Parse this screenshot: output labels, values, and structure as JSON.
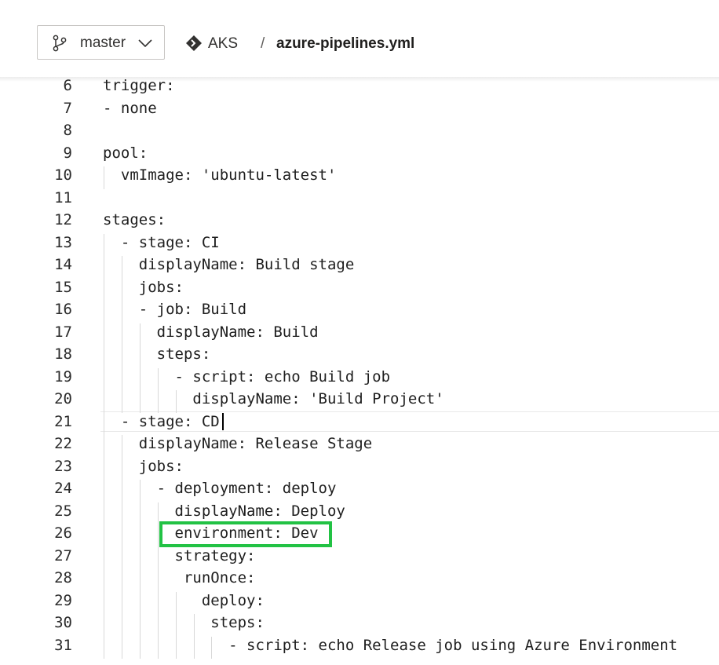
{
  "header": {
    "branch": "master",
    "repo": "AKS",
    "path_separator": "/",
    "file": "azure-pipelines.yml"
  },
  "icons": {
    "branch": "git-branch-icon",
    "chevron": "chevron-down-icon",
    "repo": "repo-diamond-icon"
  },
  "colors": {
    "highlight": "#22c244"
  },
  "editor": {
    "current_line": 21,
    "highlighted_line": 26,
    "lines": [
      {
        "n": "6",
        "code": "trigger:"
      },
      {
        "n": "7",
        "code": "- none"
      },
      {
        "n": "8",
        "code": ""
      },
      {
        "n": "9",
        "code": "pool:"
      },
      {
        "n": "10",
        "code": "  vmImage: 'ubuntu-latest'"
      },
      {
        "n": "11",
        "code": ""
      },
      {
        "n": "12",
        "code": "stages:"
      },
      {
        "n": "13",
        "code": "  - stage: CI"
      },
      {
        "n": "14",
        "code": "    displayName: Build stage"
      },
      {
        "n": "15",
        "code": "    jobs:"
      },
      {
        "n": "16",
        "code": "    - job: Build"
      },
      {
        "n": "17",
        "code": "      displayName: Build"
      },
      {
        "n": "18",
        "code": "      steps:"
      },
      {
        "n": "19",
        "code": "        - script: echo Build job"
      },
      {
        "n": "20",
        "code": "          displayName: 'Build Project'"
      },
      {
        "n": "21",
        "code": "  - stage: CD"
      },
      {
        "n": "22",
        "code": "    displayName: Release Stage"
      },
      {
        "n": "23",
        "code": "    jobs:"
      },
      {
        "n": "24",
        "code": "      - deployment: deploy"
      },
      {
        "n": "25",
        "code": "        displayName: Deploy"
      },
      {
        "n": "26",
        "code": "        environment: Dev"
      },
      {
        "n": "27",
        "code": "        strategy:"
      },
      {
        "n": "28",
        "code": "         runOnce:"
      },
      {
        "n": "29",
        "code": "           deploy:"
      },
      {
        "n": "30",
        "code": "            steps:"
      },
      {
        "n": "31",
        "code": "              - script: echo Release job using Azure Environment"
      }
    ]
  }
}
